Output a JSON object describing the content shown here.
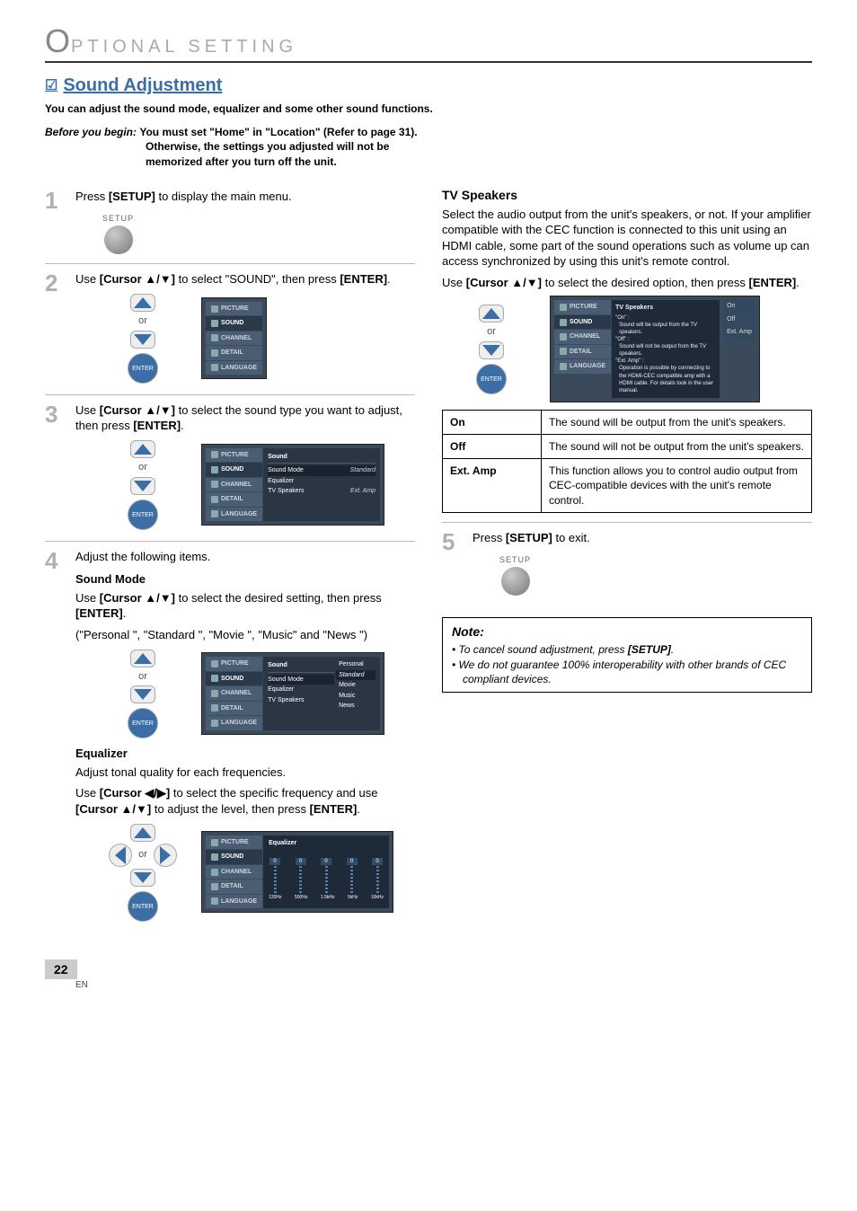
{
  "header": {
    "o": "O",
    "rest": "PTIONAL  SETTING"
  },
  "title": "Sound Adjustment",
  "intro": "You can adjust the sound mode, equalizer and some other sound functions.",
  "before": {
    "label": "Before you begin:",
    "line1": "You must set \"Home\" in \"Location\" (Refer to page 31).",
    "line2": "Otherwise, the settings you adjusted will not be",
    "line3": "memorized after you turn off the unit."
  },
  "steps": {
    "s1": {
      "t1": "Press ",
      "b1": "[SETUP]",
      "t2": " to display the main menu.",
      "setup_label": "SETUP"
    },
    "s2": {
      "t1": "Use ",
      "b1": "[Cursor ▲/▼]",
      "t2": " to select \"SOUND\", then press ",
      "b2": "[ENTER]",
      "t3": "."
    },
    "s3": {
      "t1": "Use ",
      "b1": "[Cursor ▲/▼]",
      "t2": " to select the sound type you want to adjust, then press ",
      "b2": "[ENTER]",
      "t3": "."
    },
    "s4": {
      "t1": "Adjust the following items."
    },
    "s5": {
      "t1": "Press ",
      "b1": "[SETUP]",
      "t2": " to exit.",
      "setup_label": "SETUP"
    }
  },
  "soundMode": {
    "h": "Sound Mode",
    "p1a": "Use ",
    "p1b": "[Cursor ▲/▼]",
    "p1c": " to select the desired setting, then press ",
    "p1d": "[ENTER]",
    "p1e": ".",
    "p2": "(\"Personal \", \"Standard \", \"Movie \", \"Music\" and \"News \")"
  },
  "equalizer": {
    "h": "Equalizer",
    "p1": "Adjust tonal quality for each frequencies.",
    "p2a": "Use ",
    "p2b": "[Cursor ◀/▶]",
    "p2c": " to select the specific frequency and use ",
    "p2d": "[Cursor ▲/▼]",
    "p2e": " to adjust the level, then press ",
    "p2f": "[ENTER]",
    "p2g": "."
  },
  "tvSpeakers": {
    "h": "TV Speakers",
    "p": "Select the audio output from the unit's speakers, or not. If your amplifier compatible with the CEC function is connected to this unit using an HDMI cable, some part of the sound operations such as volume up can access synchronized by using this unit's remote control.",
    "p2a": "Use ",
    "p2b": "[Cursor ▲/▼]",
    "p2c": " to select the desired option, then press ",
    "p2d": "[ENTER]",
    "p2e": "."
  },
  "tvTable": {
    "r1k": "On",
    "r1v": "The sound will be output from the unit's speakers.",
    "r2k": "Off",
    "r2v": "The sound will not be output from the unit's speakers.",
    "r3k": "Ext. Amp",
    "r3v": "This function allows you to control audio output from CEC-compatible devices with the unit's remote control."
  },
  "note": {
    "h": "Note:",
    "n1a": "To cancel sound adjustment, press ",
    "n1b": "[SETUP]",
    "n1c": ".",
    "n2": "We do not guarantee 100% interoperability with other brands of CEC compliant devices."
  },
  "menu": {
    "picture": "PICTURE",
    "sound": "SOUND",
    "channel": "CHANNEL",
    "detail": "DETAIL",
    "language": "LANGUAGE",
    "soundHdr": "Sound",
    "smode": "Sound Mode",
    "std": "Standard",
    "eq": "Equalizer",
    "tvs": "TV Speakers",
    "extamp": "Ext. Amp",
    "personal": "Personal",
    "movie": "Movie",
    "music": "Music",
    "news": "News",
    "eqHdr": "Equalizer",
    "f1": "120Hz",
    "f2": "500Hz",
    "f3": "1.5kHz",
    "f4": "5kHz",
    "f5": "10kHz",
    "zero": "0",
    "tvsHdr": "TV Speakers",
    "tvsOn": "On",
    "tvsOff": "Off",
    "tvsExt": "Ext. Amp",
    "tvsDesc1": "\"On\" :",
    "tvsDesc1b": "Sound will be output from the TV speakers.",
    "tvsDesc2": "\"Off\" :",
    "tvsDesc2b": "Sound will not be output from the TV speakers.",
    "tvsDesc3": "\"Ext. Amp\" :",
    "tvsDesc3b": "Operation is possible by connecting to the HDMI-CEC compatible amp with a HDMI cable. For details look in the user manual."
  },
  "dpad": {
    "or": "or",
    "enter": "ENTER"
  },
  "footer": {
    "page": "22",
    "en": "EN"
  }
}
